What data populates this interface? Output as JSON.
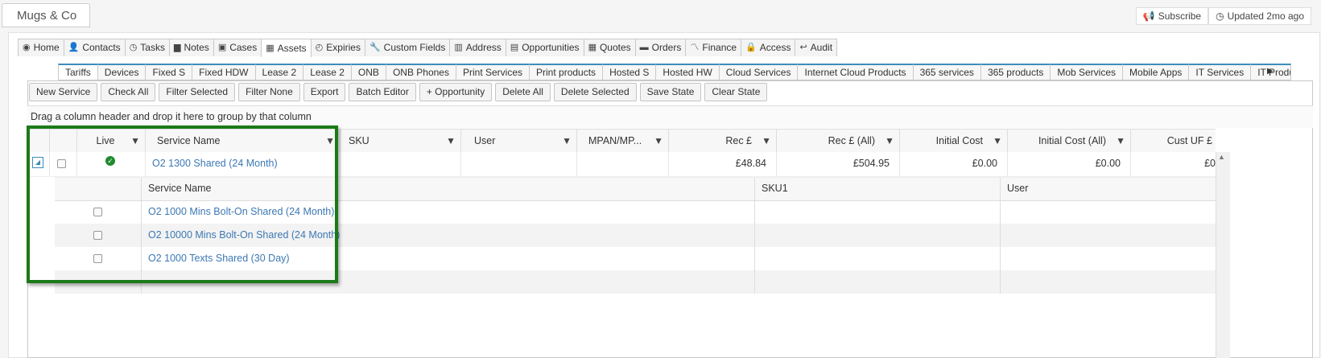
{
  "account": {
    "name": "Mugs & Co"
  },
  "header_actions": {
    "subscribe": "Subscribe",
    "updated": "Updated 2mo ago"
  },
  "main_tabs": [
    {
      "label": "Home",
      "icon": "eye-icon"
    },
    {
      "label": "Contacts",
      "icon": "user-icon"
    },
    {
      "label": "Tasks",
      "icon": "clock-icon"
    },
    {
      "label": "Notes",
      "icon": "comment-icon"
    },
    {
      "label": "Cases",
      "icon": "briefcase-icon"
    },
    {
      "label": "Assets",
      "icon": "grid-icon",
      "active": true
    },
    {
      "label": "Expiries",
      "icon": "expiry-clock-icon"
    },
    {
      "label": "Custom Fields",
      "icon": "wrench-icon"
    },
    {
      "label": "Address",
      "icon": "book-icon"
    },
    {
      "label": "Opportunities",
      "icon": "file-icon"
    },
    {
      "label": "Quotes",
      "icon": "calculator-icon"
    },
    {
      "label": "Orders",
      "icon": "card-icon"
    },
    {
      "label": "Finance",
      "icon": "chart-line-icon"
    },
    {
      "label": "Access",
      "icon": "lock-icon"
    },
    {
      "label": "Audit",
      "icon": "audit-icon"
    }
  ],
  "sub_tabs": [
    "Tariffs",
    "Devices",
    "Fixed S",
    "Fixed HDW",
    "Lease 2",
    "Lease 2",
    "ONB",
    "ONB Phones",
    "Print Services",
    "Print products",
    "Hosted S",
    "Hosted HW",
    "Cloud Services",
    "Internet Cloud Products",
    "365 services",
    "365 products",
    "Mob Services",
    "Mobile Apps",
    "IT Services",
    "IT Produ"
  ],
  "toolbar": [
    "New Service",
    "Check All",
    "Filter Selected",
    "Filter None",
    "Export",
    "Batch Editor",
    "+ Opportunity",
    "Delete All",
    "Delete Selected",
    "Save State",
    "Clear State"
  ],
  "group_hint": "Drag a column header and drop it here to group by that column",
  "columns": [
    "Live",
    "Service Name",
    "SKU",
    "User",
    "MPAN/MP...",
    "Rec £",
    "Rec £ (All)",
    "Initial Cost",
    "Initial Cost (All)",
    "Cust UF £"
  ],
  "row": {
    "service_name": "O2 1300 Shared (24 Month)",
    "rec": "£48.84",
    "rec_all": "£504.95",
    "initial_cost": "£0.00",
    "initial_cost_all": "£0.00",
    "cust_uf": "£0"
  },
  "detail": {
    "columns": [
      "Service Name",
      "SKU1",
      "User"
    ],
    "rows": [
      "O2 1000 Mins Bolt-On Shared (24 Month)",
      "O2 10000 Mins Bolt-On Shared (24 Month)",
      "O2 1000 Texts Shared (30 Day)",
      ""
    ]
  },
  "colors": {
    "highlight": "#1a7a17",
    "link": "#3c78b4",
    "live": "#1e8b2e"
  }
}
